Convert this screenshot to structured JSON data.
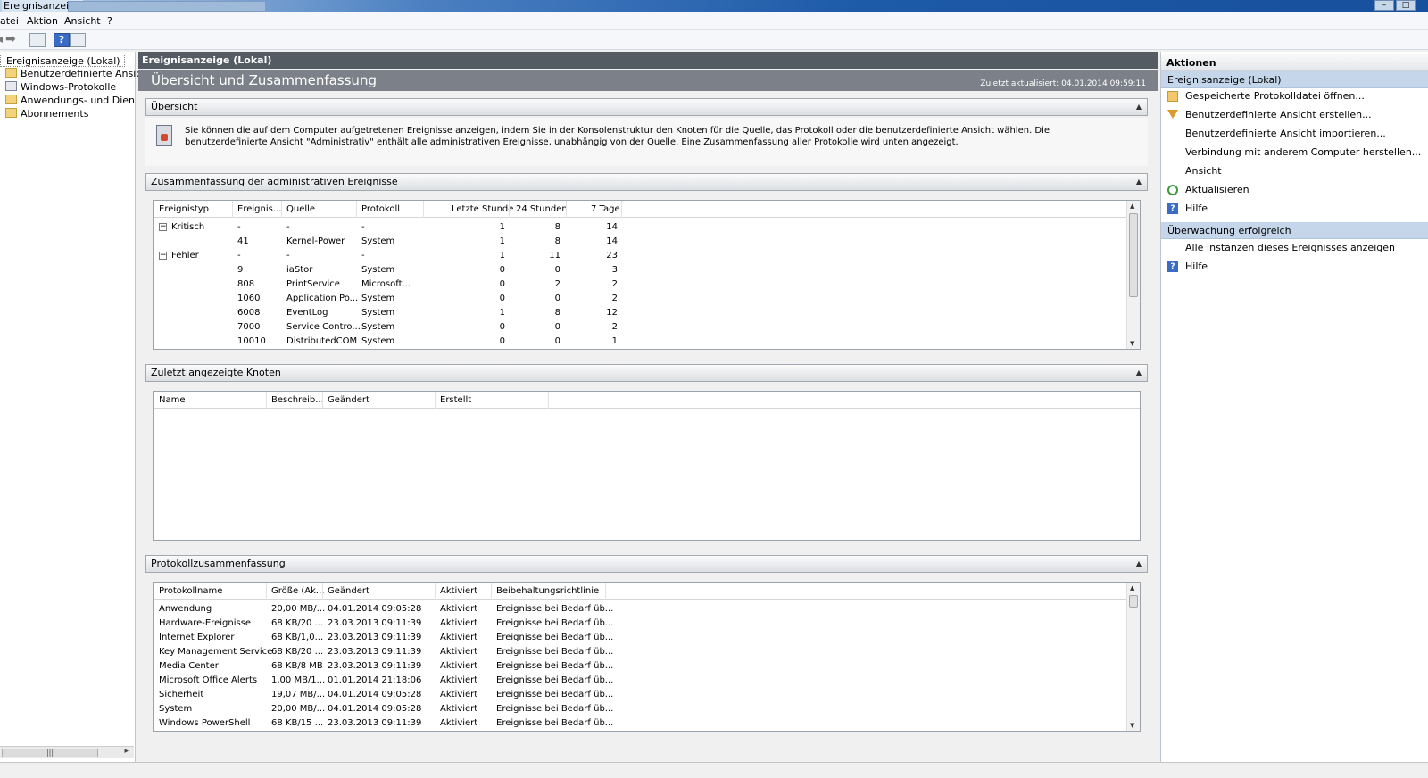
{
  "window": {
    "title": "Ereignisanzeige"
  },
  "menu": {
    "items": [
      "atei",
      "Aktion",
      "Ansicht",
      "?"
    ]
  },
  "tree": {
    "root": "Ereignisanzeige (Lokal)",
    "items": [
      "Benutzerdefinierte Ansichten",
      "Windows-Protokolle",
      "Anwendungs- und Dienstprotokolle",
      "Abonnements"
    ]
  },
  "center": {
    "header": "Ereignisanzeige (Lokal)",
    "banner_title": "Übersicht und Zusammenfassung",
    "last_updated": "Zuletzt aktualisiert: 04.01.2014 09:59:11"
  },
  "overview": {
    "title": "Übersicht",
    "text": "Sie können die auf dem Computer aufgetretenen Ereignisse anzeigen, indem Sie in der Konsolenstruktur den Knoten für die Quelle, das Protokoll oder die benutzerdefinierte Ansicht wählen. Die benutzerdefinierte Ansicht \"Administrativ\" enthält alle administrativen Ereignisse, unabhängig von der Quelle. Eine Zusammenfassung aller Protokolle wird unten angezeigt."
  },
  "admin_summary": {
    "title": "Zusammenfassung der administrativen Ereignisse",
    "columns": [
      "Ereignistyp",
      "Ereignis...",
      "Quelle",
      "Protokoll",
      "Letzte Stunde",
      "24 Stunden",
      "7 Tage"
    ],
    "rows": [
      {
        "type": "Kritisch",
        "id": "-",
        "source": "-",
        "log": "-",
        "hour": "1",
        "day": "8",
        "week": "14",
        "group": true
      },
      {
        "type": "",
        "id": "41",
        "source": "Kernel-Power",
        "log": "System",
        "hour": "1",
        "day": "8",
        "week": "14",
        "group": false
      },
      {
        "type": "Fehler",
        "id": "-",
        "source": "-",
        "log": "-",
        "hour": "1",
        "day": "11",
        "week": "23",
        "group": true
      },
      {
        "type": "",
        "id": "9",
        "source": "iaStor",
        "log": "System",
        "hour": "0",
        "day": "0",
        "week": "3",
        "group": false
      },
      {
        "type": "",
        "id": "808",
        "source": "PrintService",
        "log": "Microsoft...",
        "hour": "0",
        "day": "2",
        "week": "2",
        "group": false
      },
      {
        "type": "",
        "id": "1060",
        "source": "Application Po...",
        "log": "System",
        "hour": "0",
        "day": "0",
        "week": "2",
        "group": false
      },
      {
        "type": "",
        "id": "6008",
        "source": "EventLog",
        "log": "System",
        "hour": "1",
        "day": "8",
        "week": "12",
        "group": false
      },
      {
        "type": "",
        "id": "7000",
        "source": "Service Contro...",
        "log": "System",
        "hour": "0",
        "day": "0",
        "week": "2",
        "group": false
      },
      {
        "type": "",
        "id": "10010",
        "source": "DistributedCOM",
        "log": "System",
        "hour": "0",
        "day": "0",
        "week": "1",
        "group": false
      }
    ]
  },
  "recent_nodes": {
    "title": "Zuletzt angezeigte Knoten",
    "columns": [
      "Name",
      "Beschreib...",
      "Geändert",
      "Erstellt"
    ]
  },
  "log_summary": {
    "title": "Protokollzusammenfassung",
    "columns": [
      "Protokollname",
      "Größe (Ak...",
      "Geändert",
      "Aktiviert",
      "Beibehaltungsrichtlinie"
    ],
    "rows": [
      [
        "Anwendung",
        "20,00 MB/...",
        "04.01.2014 09:05:28",
        "Aktiviert",
        "Ereignisse bei Bedarf üb..."
      ],
      [
        "Hardware-Ereignisse",
        "68 KB/20 ...",
        "23.03.2013 09:11:39",
        "Aktiviert",
        "Ereignisse bei Bedarf üb..."
      ],
      [
        "Internet Explorer",
        "68 KB/1,0...",
        "23.03.2013 09:11:39",
        "Aktiviert",
        "Ereignisse bei Bedarf üb..."
      ],
      [
        "Key Management Service",
        "68 KB/20 ...",
        "23.03.2013 09:11:39",
        "Aktiviert",
        "Ereignisse bei Bedarf üb..."
      ],
      [
        "Media Center",
        "68 KB/8 MB",
        "23.03.2013 09:11:39",
        "Aktiviert",
        "Ereignisse bei Bedarf üb..."
      ],
      [
        "Microsoft Office Alerts",
        "1,00 MB/1...",
        "01.01.2014 21:18:06",
        "Aktiviert",
        "Ereignisse bei Bedarf üb..."
      ],
      [
        "Sicherheit",
        "19,07 MB/...",
        "04.01.2014 09:05:28",
        "Aktiviert",
        "Ereignisse bei Bedarf üb..."
      ],
      [
        "System",
        "20,00 MB/...",
        "04.01.2014 09:05:28",
        "Aktiviert",
        "Ereignisse bei Bedarf üb..."
      ],
      [
        "Windows PowerShell",
        "68 KB/15 ...",
        "23.03.2013 09:11:39",
        "Aktiviert",
        "Ereignisse bei Bedarf üb..."
      ]
    ]
  },
  "actions": {
    "title": "Aktionen",
    "group1": "Ereignisanzeige (Lokal)",
    "group1_items": [
      {
        "label": "Gespeicherte Protokolldatei öffnen...",
        "icon": "open-log-icon"
      },
      {
        "label": "Benutzerdefinierte Ansicht erstellen...",
        "icon": "filter-icon"
      },
      {
        "label": "Benutzerdefinierte Ansicht importieren...",
        "icon": ""
      },
      {
        "label": "Verbindung mit anderem Computer herstellen...",
        "icon": ""
      },
      {
        "label": "Ansicht",
        "icon": ""
      },
      {
        "label": "Aktualisieren",
        "icon": "refresh-icon"
      },
      {
        "label": "Hilfe",
        "icon": "help-icon"
      }
    ],
    "group2": "Überwachung erfolgreich",
    "group2_items": [
      {
        "label": "Alle Instanzen dieses Ereignisses anzeigen",
        "icon": ""
      },
      {
        "label": "Hilfe",
        "icon": "help-icon"
      }
    ]
  }
}
